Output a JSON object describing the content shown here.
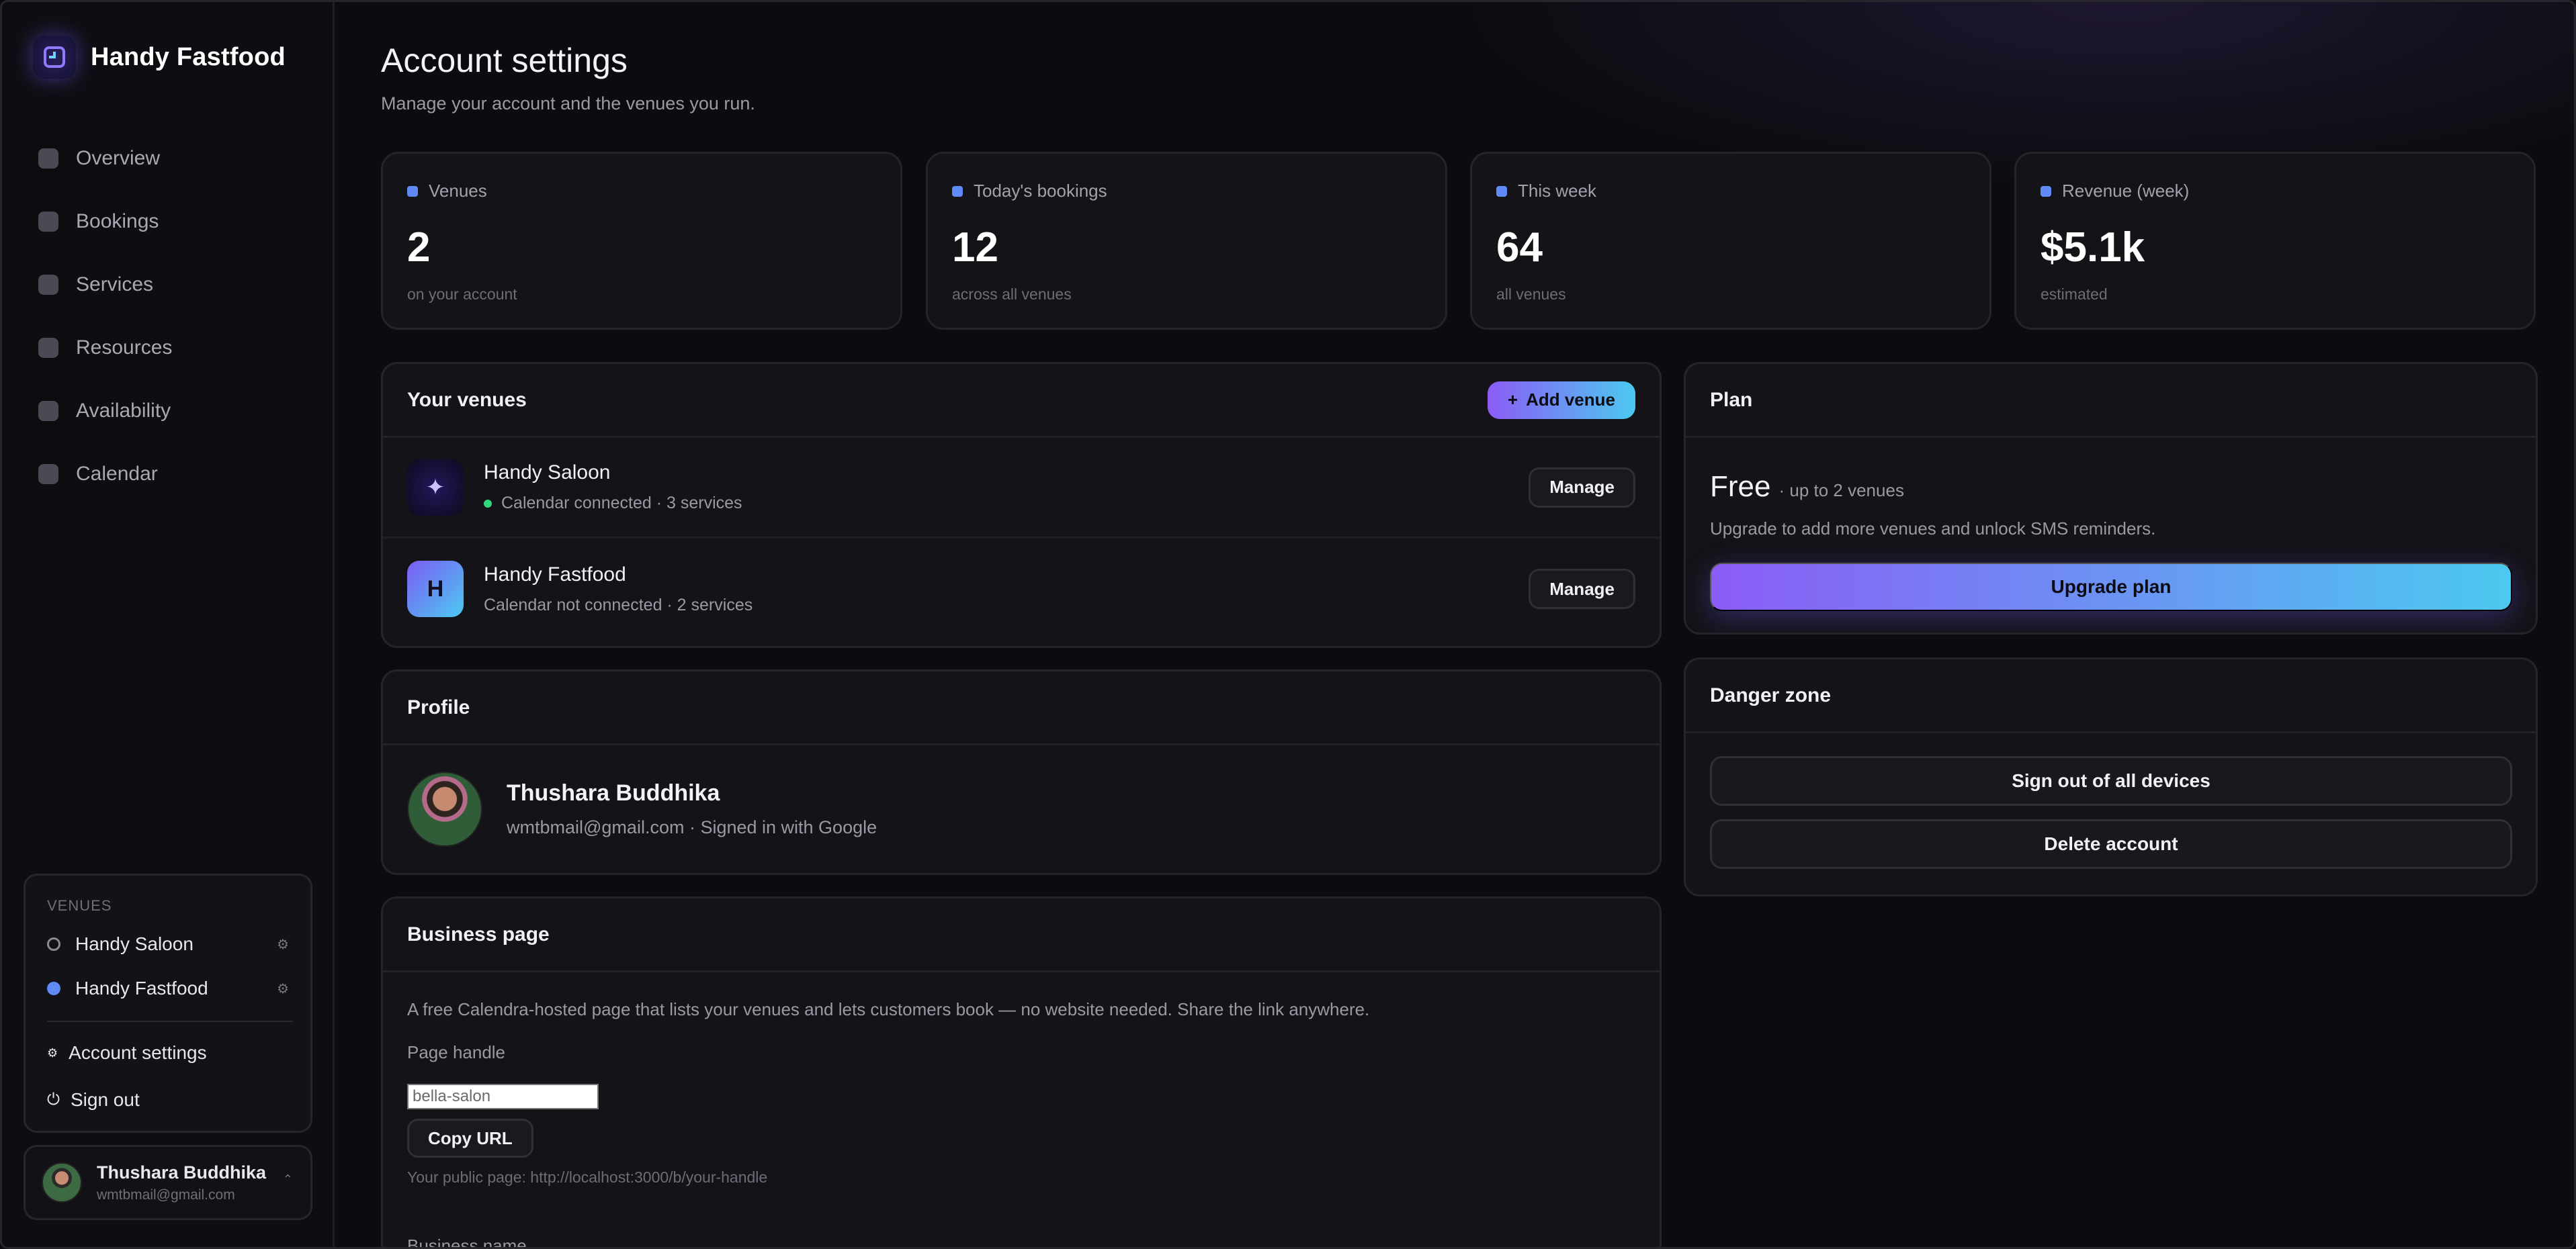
{
  "app": {
    "name": "Handy Fastfood"
  },
  "nav": {
    "items": [
      {
        "label": "Overview"
      },
      {
        "label": "Bookings"
      },
      {
        "label": "Services"
      },
      {
        "label": "Resources"
      },
      {
        "label": "Availability"
      },
      {
        "label": "Calendar"
      }
    ]
  },
  "sidebar_venues": {
    "title": "VENUES",
    "items": [
      {
        "name": "Handy Saloon",
        "active": false
      },
      {
        "name": "Handy Fastfood",
        "active": true
      }
    ],
    "account_settings": "Account settings",
    "sign_out": "Sign out"
  },
  "user": {
    "name": "Thushara Buddhika",
    "email": "wmtbmail@gmail.com"
  },
  "page": {
    "title": "Account settings",
    "subtitle": "Manage your account and the venues you run."
  },
  "stats": [
    {
      "label": "Venues",
      "value": "2",
      "note": "on your account"
    },
    {
      "label": "Today's bookings",
      "value": "12",
      "note": "across all venues"
    },
    {
      "label": "This week",
      "value": "64",
      "note": "all venues"
    },
    {
      "label": "Revenue (week)",
      "value": "$5.1k",
      "note": "estimated"
    }
  ],
  "venues_card": {
    "title": "Your venues",
    "add_label": "Add venue",
    "rows": [
      {
        "name": "Handy Saloon",
        "status": "Calendar connected · 3 services",
        "manage": "Manage",
        "initial": "✦"
      },
      {
        "name": "Handy Fastfood",
        "status": "Calendar not connected · 2 services",
        "manage": "Manage",
        "initial": "H"
      }
    ]
  },
  "profile": {
    "title": "Profile",
    "name": "Thushara Buddhika",
    "detail": "wmtbmail@gmail.com · Signed in with Google"
  },
  "business": {
    "title": "Business page",
    "description": "A free Calendra-hosted page that lists your venues and lets customers book — no website needed. Share the link anywhere.",
    "handle_label": "Page handle",
    "handle_value": "bella-salon",
    "copy_label": "Copy URL",
    "public_url": "Your public page: http://localhost:3000/b/your-handle",
    "business_name_label": "Business name"
  },
  "plan": {
    "title": "Plan",
    "name": "Free",
    "limit": "· up to 2 venues",
    "description": "Upgrade to add more venues and unlock SMS reminders.",
    "upgrade_label": "Upgrade plan"
  },
  "danger": {
    "title": "Danger zone",
    "sign_out_all": "Sign out of all devices",
    "delete": "Delete account"
  },
  "colors": {
    "accent_blue": "#5f8af8",
    "gradient_start": "#8b5cf6",
    "gradient_end": "#4cc9f0",
    "status_green": "#2fd67b"
  }
}
